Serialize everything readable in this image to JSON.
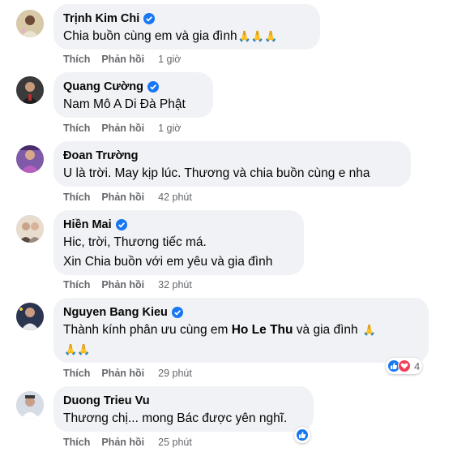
{
  "comments": [
    {
      "name": "Trịnh Kim Chi",
      "verified": true,
      "lines": [
        "Chia buồn cùng em và gia đình"
      ],
      "pray_after_line": [
        "🙏🙏🙏"
      ],
      "like_label": "Thích",
      "reply_label": "Phản hồi",
      "time": "1 giờ"
    },
    {
      "name": "Quang Cường",
      "verified": true,
      "lines": [
        "Nam Mô A Di Đà Phật"
      ],
      "like_label": "Thích",
      "reply_label": "Phản hồi",
      "time": "1 giờ"
    },
    {
      "name": "Đoan Trường",
      "verified": false,
      "lines": [
        "U là trời. May kịp lúc. Thương và chia buồn cùng e nha"
      ],
      "like_label": "Thích",
      "reply_label": "Phản hồi",
      "time": "42 phút"
    },
    {
      "name": "Hiền Mai",
      "verified": true,
      "lines": [
        "Hic, trời, Thương tiếc má.",
        "Xin Chia buồn với em yêu và gia đình"
      ],
      "like_label": "Thích",
      "reply_label": "Phản hồi",
      "time": "32 phút"
    },
    {
      "name": "Nguyen Bang Kieu",
      "verified": true,
      "line_prefix": "Thành kính phân ưu cùng em ",
      "line_bold": "Ho Le Thu",
      "line_suffix": " và gia đình",
      "pray_inline": "🙏",
      "pray_line2": "🙏🙏",
      "like_label": "Thích",
      "reply_label": "Phản hồi",
      "time": "29 phút",
      "reaction_count": "4"
    },
    {
      "name": "Duong Trieu Vu",
      "verified": false,
      "lines": [
        "Thương chị... mong Bác được yên nghĩ."
      ],
      "like_label": "Thích",
      "reply_label": "Phản hồi",
      "time": "25 phút"
    }
  ],
  "colors": {
    "bubble": "#f0f2f5",
    "verified": "#1877f2",
    "like": "#1877f2",
    "love": "#f33e58",
    "meta": "#65676b"
  },
  "icons": [
    "verified-badge-icon",
    "like-reaction-icon",
    "love-reaction-icon",
    "praying-hands-emoji"
  ]
}
